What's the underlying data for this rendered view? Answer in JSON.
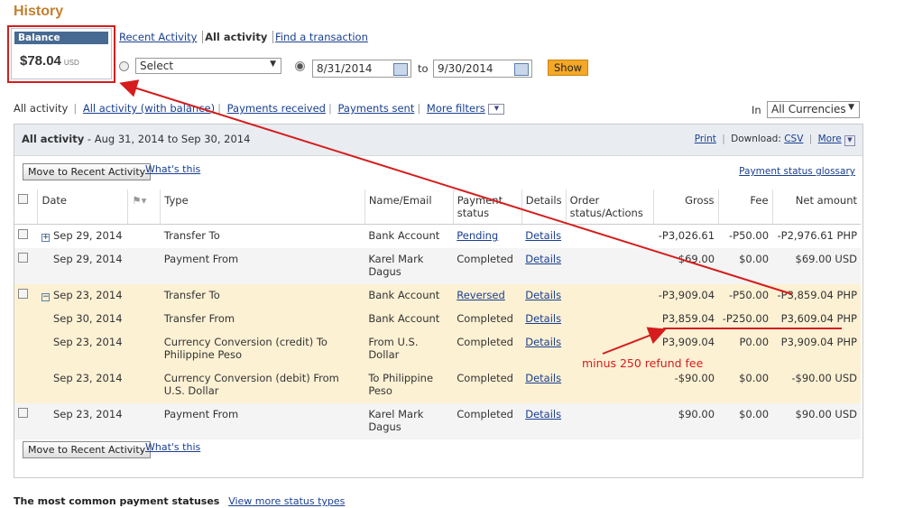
{
  "page": {
    "title": "History"
  },
  "balance": {
    "label": "Balance",
    "amount": "$78.04",
    "currency": "USD"
  },
  "views": {
    "recent": "Recent Activity",
    "all": "All activity",
    "find": "Find a transaction"
  },
  "filter": {
    "select_value": "Select",
    "from_date": "8/31/2014",
    "to_label": "to",
    "to_date": "9/30/2014",
    "show": "Show"
  },
  "tabs": {
    "all": "All activity",
    "all_balance": "All activity (with balance)",
    "received": "Payments received",
    "sent": "Payments sent",
    "more_filters": "More filters"
  },
  "currency": {
    "in_label": "In",
    "value": "All Currencies"
  },
  "panel": {
    "title": "All activity",
    "range": "- Aug 31, 2014 to Sep 30, 2014",
    "print": "Print",
    "download_label": "Download:",
    "csv": "CSV",
    "more": "More",
    "move_btn": "Move to Recent Activity",
    "whats_this": "What's this",
    "glossary": "Payment status glossary"
  },
  "columns": {
    "date": "Date",
    "type": "Type",
    "name": "Name/Email",
    "status": "Payment status",
    "details": "Details",
    "order": "Order status/Actions",
    "gross": "Gross",
    "fee": "Fee",
    "net": "Net amount"
  },
  "rows": [
    {
      "date": "Sep 29, 2014",
      "type": "Transfer To",
      "name": "Bank Account",
      "status": "Pending",
      "details": "Details",
      "gross": "-P3,026.61",
      "fee": "-P50.00",
      "net": "-P2,976.61 PHP"
    },
    {
      "date": "Sep 29, 2014",
      "type": "Payment From",
      "name": "Karel Mark Dagus",
      "status": "Completed",
      "details": "Details",
      "gross": "$69.00",
      "fee": "$0.00",
      "net": "$69.00 USD"
    },
    {
      "date": "Sep 23, 2014",
      "type": "Transfer To",
      "name": "Bank Account",
      "status": "Reversed",
      "details": "Details",
      "gross": "-P3,909.04",
      "fee": "-P50.00",
      "net": "-P3,859.04 PHP"
    },
    {
      "date": "Sep 30, 2014",
      "type": "Transfer From",
      "name": "Bank Account",
      "status": "Completed",
      "details": "Details",
      "gross": "P3,859.04",
      "fee": "-P250.00",
      "net": "P3,609.04 PHP"
    },
    {
      "date": "Sep 23, 2014",
      "type": "Currency Conversion (credit) To Philippine Peso",
      "name": "From U.S. Dollar",
      "status": "Completed",
      "details": "Details",
      "gross": "P3,909.04",
      "fee": "P0.00",
      "net": "P3,909.04 PHP"
    },
    {
      "date": "Sep 23, 2014",
      "type": "Currency Conversion (debit) From U.S. Dollar",
      "name": "To Philippine Peso",
      "status": "Completed",
      "details": "Details",
      "gross": "-$90.00",
      "fee": "$0.00",
      "net": "-$90.00 USD"
    },
    {
      "date": "Sep 23, 2014",
      "type": "Payment From",
      "name": "Karel Mark Dagus",
      "status": "Completed",
      "details": "Details",
      "gross": "$90.00",
      "fee": "$0.00",
      "net": "$90.00 USD"
    }
  ],
  "annotation": "minus 250 refund fee",
  "footer": {
    "label": "The most common payment statuses",
    "link": "View more status types"
  },
  "colors": {
    "accent": "#c47f2d",
    "annotation": "#d61c1c",
    "link": "#1a3f8f",
    "show_button": "#f4a826",
    "highlight_row": "#fdf1d4"
  }
}
